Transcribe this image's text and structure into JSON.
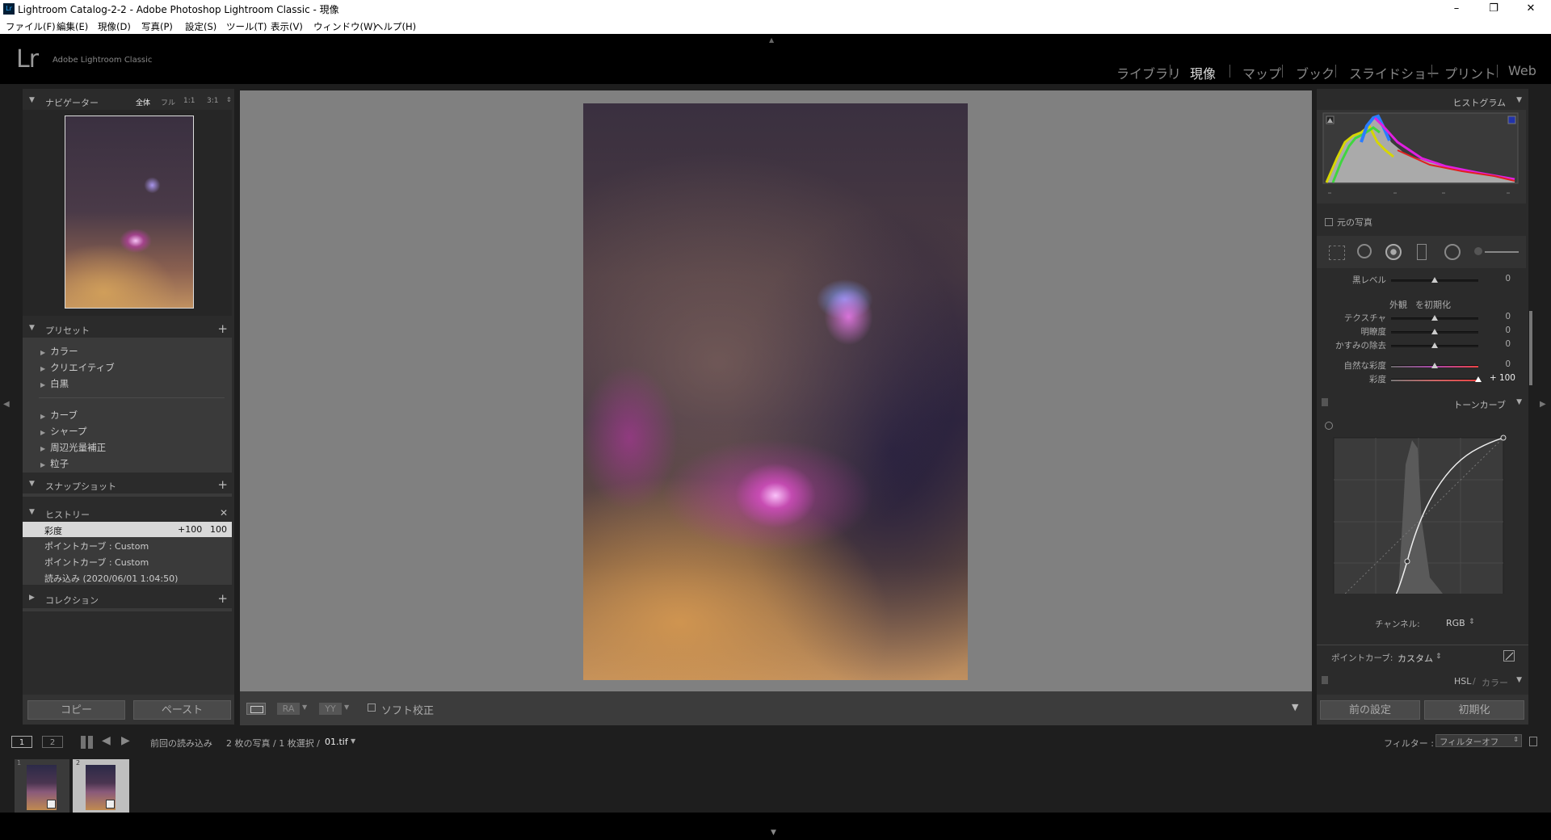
{
  "window": {
    "title": "Lightroom Catalog-2-2 - Adobe Photoshop Lightroom Classic - 現像",
    "app_icon": "Lr",
    "controls": [
      "–",
      "❐",
      "✕"
    ]
  },
  "menu": [
    "ファイル(F)",
    "編集(E)",
    "現像(D)",
    "写真(P)",
    "設定(S)",
    "ツール(T)",
    "表示(V)",
    "ウィンドウ(W)",
    "ヘルプ(H)"
  ],
  "brand": {
    "logo": "Lr",
    "name": "Adobe Lightroom Classic"
  },
  "modules": [
    "ライブラリ",
    "現像",
    "マップ",
    "ブック",
    "スライドショー",
    "プリント",
    "Web"
  ],
  "active_module": "現像",
  "navigator": {
    "title": "ナビゲーター",
    "zoom_options": [
      "全体",
      "フル",
      "1:1",
      "3:1"
    ]
  },
  "presets": {
    "title": "プリセット",
    "group1": [
      "カラー",
      "クリエイティブ",
      "白黒"
    ],
    "group2": [
      "カーブ",
      "シャープ",
      "周辺光量補正",
      "粒子"
    ]
  },
  "snapshot": {
    "title": "スナップショット"
  },
  "history": {
    "title": "ヒストリー",
    "items": [
      {
        "label": "彩度",
        "from": "+100",
        "to": "100"
      },
      {
        "label": "ポイントカーブ : Custom"
      },
      {
        "label": "ポイントカーブ : Custom"
      },
      {
        "label": "読み込み (2020/06/01 1:04:50)"
      }
    ]
  },
  "collection": {
    "title": "コレクション"
  },
  "left_buttons": {
    "copy": "コピー",
    "paste": "ペースト"
  },
  "toolbar": {
    "soft_proof": "ソフト校正",
    "ra": "RA",
    "yy": "YY"
  },
  "histogram": {
    "title": "ヒストグラム",
    "original_photo": "元の写真"
  },
  "basic": {
    "black_level": {
      "label": "黒レベル",
      "value": "0"
    },
    "presence": "外観",
    "reset": "を初期化",
    "sliders": [
      {
        "label": "テクスチャ",
        "value": "0"
      },
      {
        "label": "明瞭度",
        "value": "0"
      },
      {
        "label": "かすみの除去",
        "value": "0"
      },
      {
        "label": "自然な彩度",
        "value": "0"
      },
      {
        "label": "彩度",
        "value": "+ 100"
      }
    ]
  },
  "tone_curve": {
    "title": "トーンカーブ",
    "channel_label": "チャンネル:",
    "channel_value": "RGB",
    "point_curve_label": "ポイントカーブ:",
    "point_curve_value": "カスタム"
  },
  "hsl": {
    "title": "HSL",
    "sep": "/",
    "color": "カラー"
  },
  "right_buttons": {
    "previous": "前の設定",
    "reset": "初期化"
  },
  "filmbar": {
    "page1": "1",
    "page2": "2",
    "source": "前回の読み込み",
    "count": "2 枚の写真 / 1 枚選択 /",
    "filename": "01.tif",
    "filter_label": "フィルター :",
    "filter_value": "フィルターオフ"
  },
  "thumbnails": [
    {
      "index": "1"
    },
    {
      "index": "2"
    }
  ]
}
